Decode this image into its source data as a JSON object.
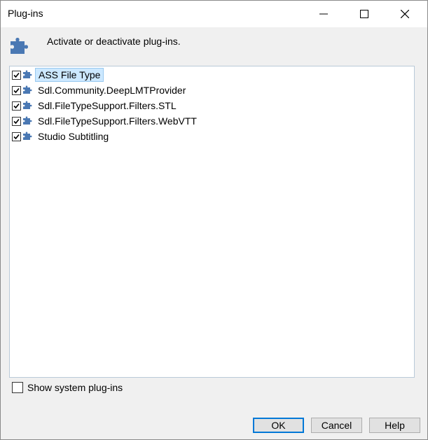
{
  "window": {
    "title": "Plug-ins"
  },
  "titlebar_buttons": {
    "minimize": "minimize-icon",
    "maximize": "maximize-icon",
    "close": "close-icon"
  },
  "header": {
    "icon": "puzzle-piece-icon",
    "text": "Activate or deactivate plug-ins."
  },
  "plugins": [
    {
      "label": "ASS File Type",
      "checked": true,
      "selected": true
    },
    {
      "label": "Sdl.Community.DeepLMTProvider",
      "checked": true,
      "selected": false
    },
    {
      "label": "Sdl.FileTypeSupport.Filters.STL",
      "checked": true,
      "selected": false
    },
    {
      "label": "Sdl.FileTypeSupport.Filters.WebVTT",
      "checked": true,
      "selected": false
    },
    {
      "label": "Studio Subtitling",
      "checked": true,
      "selected": false
    }
  ],
  "show_system": {
    "label": "Show system plug-ins",
    "checked": false
  },
  "buttons": {
    "ok": "OK",
    "cancel": "Cancel",
    "help": "Help"
  },
  "colors": {
    "accent": "#0078d7",
    "icon_blue": "#4a78b3",
    "selection": "#cce8ff"
  }
}
